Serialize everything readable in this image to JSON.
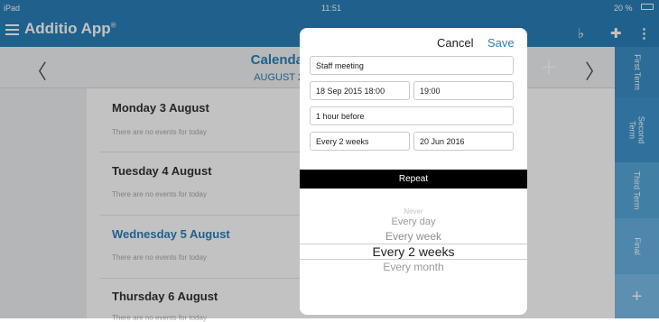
{
  "status": {
    "left": "iPad",
    "time": "11:51",
    "battery": "20 %"
  },
  "app": {
    "title": "Additio App",
    "mark": "®",
    "color": "#2a80b9"
  },
  "calendar": {
    "title": "Calenda",
    "subtitle": "AUGUST 2",
    "prev": "〈",
    "next": "〉",
    "add": "+",
    "days": [
      {
        "title": "Monday 3 August",
        "note": "There are no events for today"
      },
      {
        "title": "Tuesday 4 August",
        "note": "There are no events for today"
      },
      {
        "title": "Wednesday 5 August",
        "note": "There are no events for today"
      },
      {
        "title": "Thursday 6 August",
        "note": "There are no events for today"
      }
    ]
  },
  "tabs": {
    "first": "First Term",
    "second_a": "Second",
    "second_b": "Term",
    "third": "Third Term",
    "final": "Final",
    "add": "+"
  },
  "modal": {
    "cancel": "Cancel",
    "save": "Save",
    "title_value": "Staff meeting",
    "start": "18 Sep 2015 18:00",
    "end": "19:00",
    "reminder": "1 hour before",
    "repeat_value": "Every 2 weeks",
    "until": "20 Jun 2016",
    "repeat_header": "Repeat",
    "options": [
      "Never",
      "Every day",
      "Every week",
      "Every 2 weeks",
      "Every month"
    ],
    "selected_index": 3
  }
}
